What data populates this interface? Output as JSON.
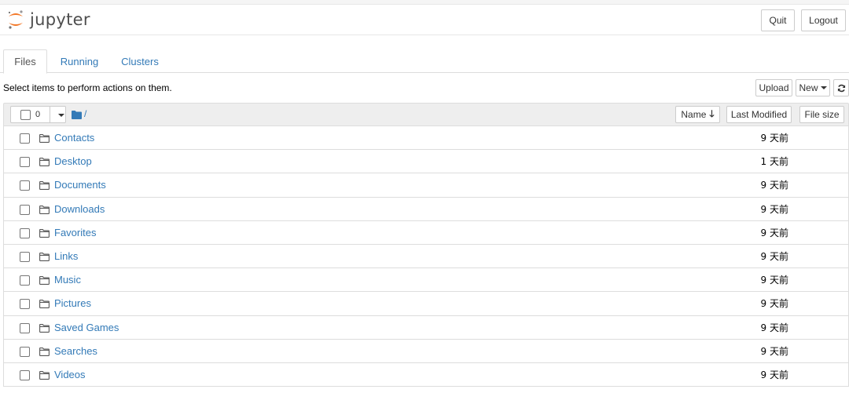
{
  "header": {
    "logo_text": "jupyter",
    "quit_label": "Quit",
    "logout_label": "Logout"
  },
  "tabs": [
    {
      "label": "Files",
      "active": true
    },
    {
      "label": "Running",
      "active": false
    },
    {
      "label": "Clusters",
      "active": false
    }
  ],
  "toolbar": {
    "instruction": "Select items to perform actions on them.",
    "upload_label": "Upload",
    "new_label": "New",
    "refresh_icon": "refresh-icon"
  },
  "list_header": {
    "selected_count": "0",
    "breadcrumb": "/",
    "sort_name_label": "Name",
    "sort_name_arrow": "🡓",
    "last_modified_label": "Last Modified",
    "file_size_label": "File size"
  },
  "files": [
    {
      "name": "Contacts",
      "modified": "9 天前"
    },
    {
      "name": "Desktop",
      "modified": "1 天前"
    },
    {
      "name": "Documents",
      "modified": "9 天前"
    },
    {
      "name": "Downloads",
      "modified": "9 天前"
    },
    {
      "name": "Favorites",
      "modified": "9 天前"
    },
    {
      "name": "Links",
      "modified": "9 天前"
    },
    {
      "name": "Music",
      "modified": "9 天前"
    },
    {
      "name": "Pictures",
      "modified": "9 天前"
    },
    {
      "name": "Saved Games",
      "modified": "9 天前"
    },
    {
      "name": "Searches",
      "modified": "9 天前"
    },
    {
      "name": "Videos",
      "modified": "9 天前"
    }
  ],
  "colors": {
    "link": "#337ab7",
    "brand_orange": "#f37726",
    "list_header_bg": "#eeeeee",
    "border": "#dddddd"
  }
}
